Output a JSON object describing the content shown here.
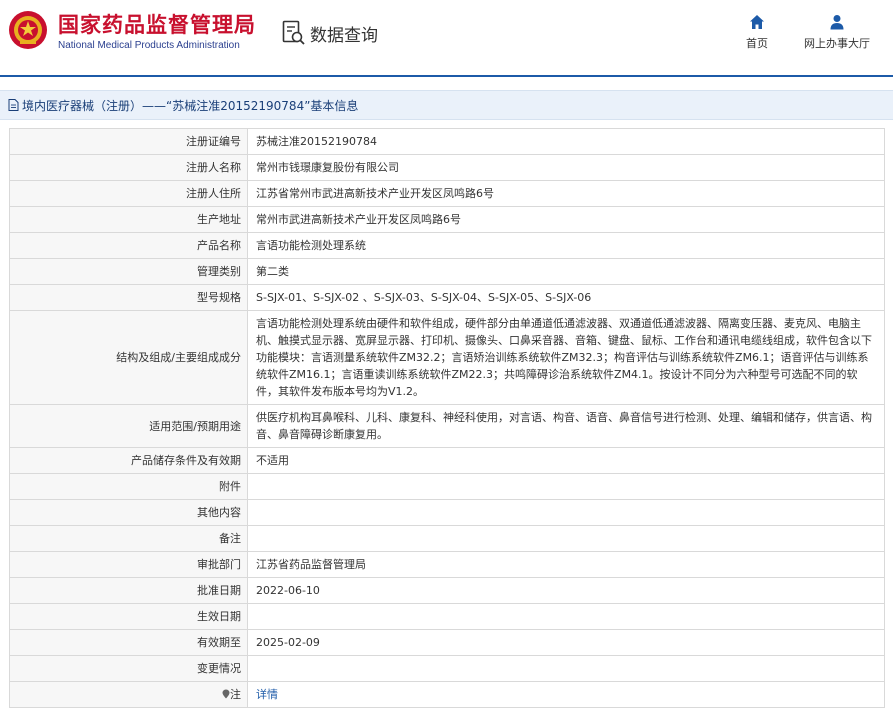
{
  "header": {
    "brand_cn": "国家药品监督管理局",
    "brand_en": "National Medical Products Administration",
    "search_title": "数据查询",
    "nav": [
      {
        "label": "首页",
        "icon": "home-icon"
      },
      {
        "label": "网上办事大厅",
        "icon": "user-icon"
      }
    ]
  },
  "breadcrumb": {
    "text": "境内医疗器械（注册）——“苏械注准20152190784”基本信息",
    "icon": "document-icon"
  },
  "colors": {
    "brand_red": "#c8102e",
    "brand_blue": "#1c5aa8",
    "crumb_bg": "#eaf1fa",
    "label_bg": "#f7f7f7",
    "link": "#1c5aa8"
  },
  "rows": [
    {
      "label": "注册证编号",
      "value": "苏械注准20152190784"
    },
    {
      "label": "注册人名称",
      "value": "常州市钱璟康复股份有限公司"
    },
    {
      "label": "注册人住所",
      "value": "江苏省常州市武进高新技术产业开发区凤鸣路6号"
    },
    {
      "label": "生产地址",
      "value": "常州市武进高新技术产业开发区凤鸣路6号"
    },
    {
      "label": "产品名称",
      "value": "言语功能检测处理系统"
    },
    {
      "label": "管理类别",
      "value": "第二类"
    },
    {
      "label": "型号规格",
      "value": "S-SJX-01、S-SJX-02 、S-SJX-03、S-SJX-04、S-SJX-05、S-SJX-06"
    },
    {
      "label": "结构及组成/主要组成成分",
      "value": "言语功能检测处理系统由硬件和软件组成，硬件部分由单通道低通滤波器、双通道低通滤波器、隔离变压器、麦克风、电脑主机、触摸式显示器、宽屏显示器、打印机、摄像头、口鼻采音器、音箱、键盘、鼠标、工作台和通讯电缆线组成，软件包含以下功能模块：言语测量系统软件ZM32.2；言语矫治训练系统软件ZM32.3；构音评估与训练系统软件ZM6.1；语音评估与训练系统软件ZM16.1；言语重读训练系统软件ZM22.3；共鸣障碍诊治系统软件ZM4.1。按设计不同分为六种型号可选配不同的软件，其软件发布版本号均为V1.2。"
    },
    {
      "label": "适用范围/预期用途",
      "value": "供医疗机构耳鼻喉科、儿科、康复科、神经科使用，对言语、构音、语音、鼻音信号进行检测、处理、编辑和储存，供言语、构音、鼻音障碍诊断康复用。"
    },
    {
      "label": "产品储存条件及有效期",
      "value": "不适用"
    },
    {
      "label": "附件",
      "value": ""
    },
    {
      "label": "其他内容",
      "value": ""
    },
    {
      "label": "备注",
      "value": ""
    },
    {
      "label": "审批部门",
      "value": "江苏省药品监督管理局"
    },
    {
      "label": "批准日期",
      "value": "2022-06-10"
    },
    {
      "label": "生效日期",
      "value": ""
    },
    {
      "label": "有效期至",
      "value": "2025-02-09"
    },
    {
      "label": "变更情况",
      "value": ""
    },
    {
      "label": "注",
      "value": "详情",
      "label_icon": "pin-icon",
      "link": true
    }
  ]
}
